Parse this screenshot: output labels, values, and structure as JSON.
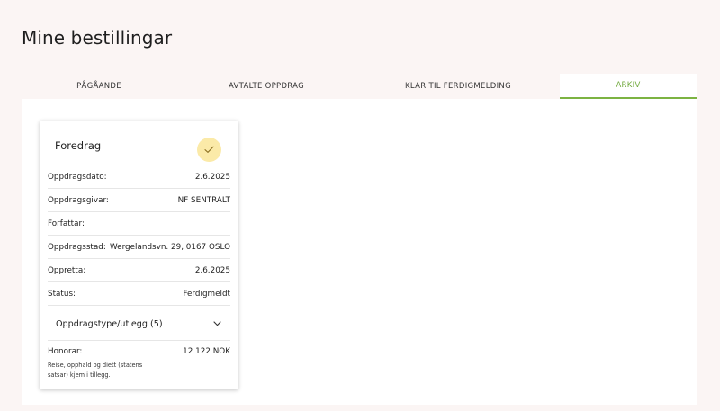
{
  "page": {
    "title": "Mine bestillingar"
  },
  "tabs": [
    {
      "label": "PÅGÅANDE",
      "active": false
    },
    {
      "label": "AVTALTE OPPDRAG",
      "active": false
    },
    {
      "label": "KLAR TIL FERDIGMELDING",
      "active": false
    },
    {
      "label": "ARKIV",
      "active": true
    }
  ],
  "card": {
    "title": "Foredrag",
    "status_icon": "check-icon",
    "rows": [
      {
        "label": "Oppdragsdato:",
        "value": "2.6.2025"
      },
      {
        "label": "Oppdragsgivar:",
        "value": "NF SENTRALT"
      },
      {
        "label": "Forfattar:",
        "value": ""
      },
      {
        "label": "Oppdragsstad:",
        "value": "Wergelandsvn. 29, 0167 OSLO"
      },
      {
        "label": "Oppretta:",
        "value": "2.6.2025"
      },
      {
        "label": "Status:",
        "value": "Ferdigmeldt"
      }
    ],
    "accordion": {
      "label": "Oppdragstype/utlegg (5)",
      "icon": "chevron-down-icon"
    },
    "honorar": {
      "label": "Honorar:",
      "value": "12 122 NOK",
      "note": "Reise, opphald og diett (statens satsar) kjem i tillegg."
    }
  },
  "colors": {
    "background": "#fbf5f4",
    "active_tab": "#7cb342",
    "check_badge": "#fbeaa8"
  }
}
